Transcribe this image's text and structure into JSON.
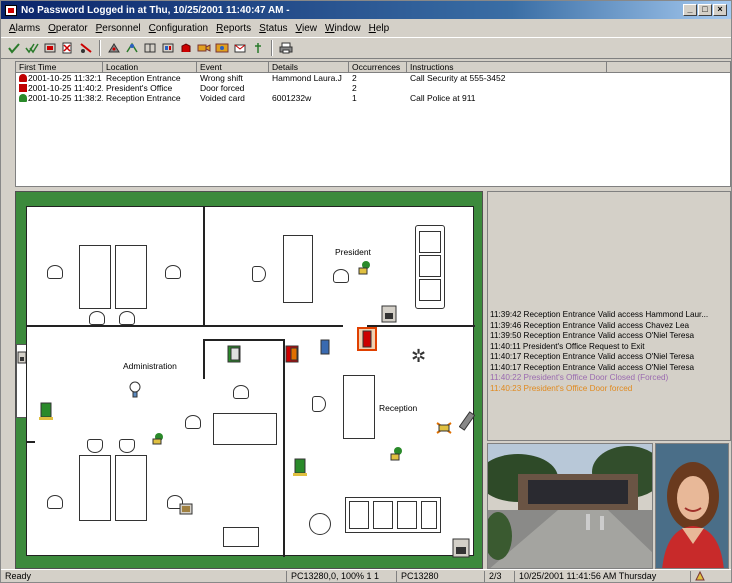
{
  "window": {
    "title": "No Password Logged in at Thu, 10/25/2001 11:40:47 AM -",
    "min": "_",
    "max": "□",
    "close": "×"
  },
  "menu": [
    "Alarms",
    "Operator",
    "Personnel",
    "Configuration",
    "Reports",
    "Status",
    "View",
    "Window",
    "Help"
  ],
  "alarms": {
    "columns": [
      "First Time",
      "Location",
      "Event",
      "Details",
      "Occurrences",
      "Instructions"
    ],
    "rows": [
      {
        "time": "2001-10-25 11:32:1",
        "location": "Reception Entrance",
        "event": "Wrong shift",
        "details": "Hammond Laura.J",
        "occ": "2",
        "instructions": "Call Security at 555-3452",
        "color": "#c00000"
      },
      {
        "time": "2001-10-25 11:40:2...",
        "location": "President's Office",
        "event": "Door forced",
        "details": "",
        "occ": "2",
        "instructions": "",
        "color": "#c00000"
      },
      {
        "time": "2001-10-25 11:38:2...",
        "location": "Reception Entrance",
        "event": "Voided card",
        "details": "6001232w",
        "occ": "1",
        "instructions": "Call Police at 911",
        "color": "#2a8a2a"
      }
    ]
  },
  "plan": {
    "rooms": {
      "president": "President",
      "administration": "Administration",
      "reception": "Reception"
    }
  },
  "events": [
    {
      "text": "11:39:42  Reception Entrance  Valid access  Hammond Laur...",
      "color": "#000000"
    },
    {
      "text": "11:39:46  Reception Entrance  Valid access  Chavez Lea",
      "color": "#000000"
    },
    {
      "text": "11:39:50  Reception Entrance  Valid access  O'Niel Teresa",
      "color": "#000000"
    },
    {
      "text": "11:40:11  President's Office  Request to Exit",
      "color": "#000000"
    },
    {
      "text": "11:40:17  Reception Entrance  Valid access  O'Niel Teresa",
      "color": "#000000"
    },
    {
      "text": "11:40:17  Reception Entrance  Valid access  O'Niel Teresa",
      "color": "#000000"
    },
    {
      "text": "11:40:22  President's Office  Door Closed (Forced)",
      "color": "#9a6ab0"
    },
    {
      "text": "11:40:23  President's Office  Door forced",
      "color": "#e08a20"
    }
  ],
  "status": {
    "ready": "Ready",
    "pc": "PC13280,0, 100% 1 1",
    "host": "PC13280",
    "page": "2/3",
    "datetime": "10/25/2001 11:41:56 AM  Thursday"
  },
  "colors": {
    "titlebar": "#0a246a",
    "floor_green": "#3c8a3c",
    "alarm_red": "#c00000",
    "ok_green": "#2a8a2a"
  }
}
